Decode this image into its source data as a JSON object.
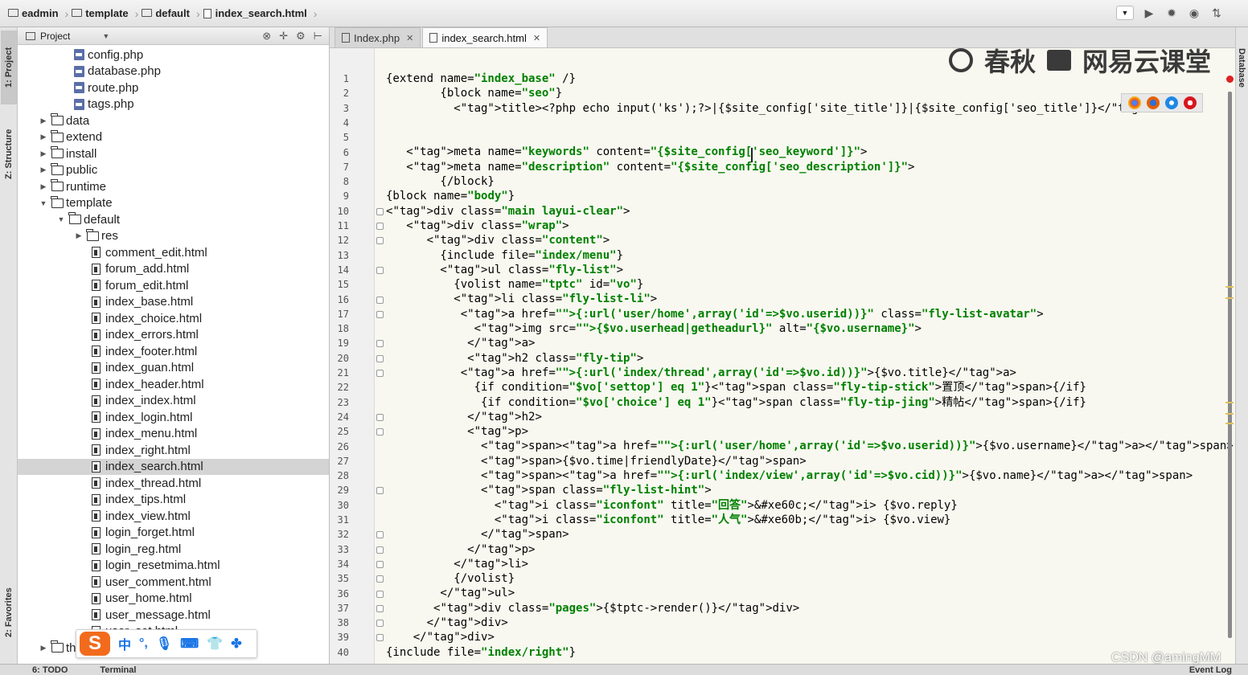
{
  "breadcrumb": [
    "eadmin",
    "template",
    "default",
    "index_search.html"
  ],
  "project_panel": {
    "title": "Project",
    "tree": [
      {
        "label": "config.php",
        "type": "php",
        "depth": 3,
        "arrow": ""
      },
      {
        "label": "database.php",
        "type": "php",
        "depth": 3,
        "arrow": ""
      },
      {
        "label": "route.php",
        "type": "php",
        "depth": 3,
        "arrow": ""
      },
      {
        "label": "tags.php",
        "type": "php",
        "depth": 3,
        "arrow": ""
      },
      {
        "label": "data",
        "type": "folder",
        "depth": 1,
        "arrow": "▶"
      },
      {
        "label": "extend",
        "type": "folder",
        "depth": 1,
        "arrow": "▶"
      },
      {
        "label": "install",
        "type": "folder",
        "depth": 1,
        "arrow": "▶"
      },
      {
        "label": "public",
        "type": "folder",
        "depth": 1,
        "arrow": "▶"
      },
      {
        "label": "runtime",
        "type": "folder",
        "depth": 1,
        "arrow": "▶"
      },
      {
        "label": "template",
        "type": "folder",
        "depth": 1,
        "arrow": "▼"
      },
      {
        "label": "default",
        "type": "folder",
        "depth": 2,
        "arrow": "▼"
      },
      {
        "label": "res",
        "type": "folder",
        "depth": 3,
        "arrow": "▶"
      },
      {
        "label": "comment_edit.html",
        "type": "html",
        "depth": 4,
        "arrow": ""
      },
      {
        "label": "forum_add.html",
        "type": "html",
        "depth": 4,
        "arrow": ""
      },
      {
        "label": "forum_edit.html",
        "type": "html",
        "depth": 4,
        "arrow": ""
      },
      {
        "label": "index_base.html",
        "type": "html",
        "depth": 4,
        "arrow": ""
      },
      {
        "label": "index_choice.html",
        "type": "html",
        "depth": 4,
        "arrow": ""
      },
      {
        "label": "index_errors.html",
        "type": "html",
        "depth": 4,
        "arrow": ""
      },
      {
        "label": "index_footer.html",
        "type": "html",
        "depth": 4,
        "arrow": ""
      },
      {
        "label": "index_guan.html",
        "type": "html",
        "depth": 4,
        "arrow": ""
      },
      {
        "label": "index_header.html",
        "type": "html",
        "depth": 4,
        "arrow": ""
      },
      {
        "label": "index_index.html",
        "type": "html",
        "depth": 4,
        "arrow": ""
      },
      {
        "label": "index_login.html",
        "type": "html",
        "depth": 4,
        "arrow": ""
      },
      {
        "label": "index_menu.html",
        "type": "html",
        "depth": 4,
        "arrow": ""
      },
      {
        "label": "index_right.html",
        "type": "html",
        "depth": 4,
        "arrow": ""
      },
      {
        "label": "index_search.html",
        "type": "html",
        "depth": 4,
        "arrow": "",
        "selected": true
      },
      {
        "label": "index_thread.html",
        "type": "html",
        "depth": 4,
        "arrow": ""
      },
      {
        "label": "index_tips.html",
        "type": "html",
        "depth": 4,
        "arrow": ""
      },
      {
        "label": "index_view.html",
        "type": "html",
        "depth": 4,
        "arrow": ""
      },
      {
        "label": "login_forget.html",
        "type": "html",
        "depth": 4,
        "arrow": ""
      },
      {
        "label": "login_reg.html",
        "type": "html",
        "depth": 4,
        "arrow": ""
      },
      {
        "label": "login_resetmima.html",
        "type": "html",
        "depth": 4,
        "arrow": ""
      },
      {
        "label": "user_comment.html",
        "type": "html",
        "depth": 4,
        "arrow": ""
      },
      {
        "label": "user_home.html",
        "type": "html",
        "depth": 4,
        "arrow": ""
      },
      {
        "label": "user_message.html",
        "type": "html",
        "depth": 4,
        "arrow": ""
      },
      {
        "label": "user_set.html",
        "type": "html",
        "depth": 4,
        "arrow": ""
      },
      {
        "label": "thinkphp",
        "type": "folder",
        "depth": 1,
        "arrow": "▶"
      }
    ]
  },
  "side_tabs": {
    "project": "1: Project",
    "structure": "Z: Structure",
    "favorites": "2: Favorites",
    "database": "Database"
  },
  "editor_tabs": [
    {
      "label": "Index.php",
      "active": false
    },
    {
      "label": "index_search.html",
      "active": true
    }
  ],
  "watermark": {
    "left": "春秋",
    "right": "网易云课堂"
  },
  "code_lines": [
    "{extend name=\"index_base\" /}",
    "        {block name=\"seo\"}",
    "          <title><?php echo input('ks');?>|{$site_config['site_title']}|{$site_config['seo_title']}</title>",
    "",
    "",
    "   <meta name=\"keywords\" content=\"{$site_config['seo_keyword']}\">",
    "   <meta name=\"description\" content=\"{$site_config['seo_description']}\">",
    "        {/block}",
    "{block name=\"body\"}",
    "<div class=\"main layui-clear\">",
    "   <div class=\"wrap\">",
    "      <div class=\"content\">",
    "        {include file=\"index/menu\"}",
    "        <ul class=\"fly-list\">",
    "          {volist name=\"tptc\" id=\"vo\"}",
    "          <li class=\"fly-list-li\">",
    "           <a href=\"{:url('user/home',array('id'=>$vo.userid))}\" class=\"fly-list-avatar\">",
    "             <img src=\"{$vo.userhead|getheadurl}\" alt=\"{$vo.username}\">",
    "            </a>",
    "            <h2 class=\"fly-tip\">",
    "           <a href=\"{:url('index/thread',array('id'=>$vo.id))}\">{$vo.title}</a>",
    "             {if condition=\"$vo['settop'] eq 1\"}<span class=\"fly-tip-stick\">置顶</span>{/if}",
    "              {if condition=\"$vo['choice'] eq 1\"}<span class=\"fly-tip-jing\">精帖</span>{/if}",
    "            </h2>",
    "            <p>",
    "              <span><a href=\"{:url('user/home',array('id'=>$vo.userid))}\">{$vo.username}</a></span>",
    "              <span>{$vo.time|friendlyDate}</span>",
    "              <span><a href=\"{:url('index/view',array('id'=>$vo.cid))}\">{$vo.name}</a></span>",
    "              <span class=\"fly-list-hint\">",
    "                <i class=\"iconfont\" title=\"回答\">&#xe60c;</i> {$vo.reply}",
    "                <i class=\"iconfont\" title=\"人气\">&#xe60b;</i> {$vo.view}",
    "              </span>",
    "            </p>",
    "          </li>",
    "          {/volist}",
    "        </ul>",
    "       <div class=\"pages\">{$tptc->render()}</div>",
    "      </div>",
    "    </div>",
    "{include file=\"index/right\"}"
  ],
  "ime": {
    "lang": "中",
    "punct": "°,"
  },
  "bottom_bar": {
    "todo": "6: TODO",
    "terminal": "Terminal",
    "event_log": "Event Log"
  },
  "credit": "CSDN @amingMM",
  "colors": {
    "tag": "#000080",
    "attr": "#0000ff",
    "string": "#008000",
    "highlight": "#f5d787",
    "ime_brand": "#f26b1d"
  }
}
